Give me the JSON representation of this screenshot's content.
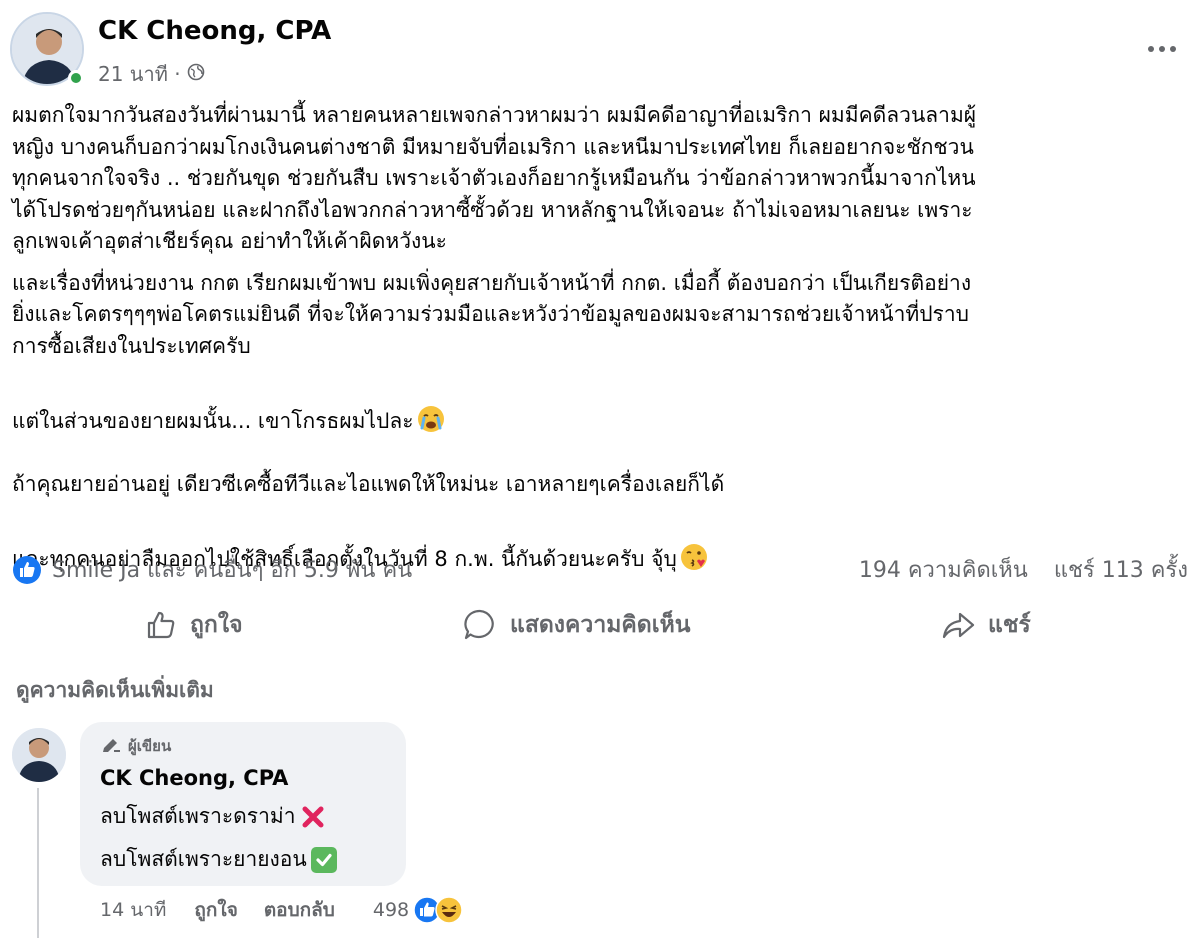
{
  "post": {
    "author": "CK Cheong, CPA",
    "time": "21 นาที ·",
    "paragraphs": [
      "ผมตกใจมากวันสองวันที่ผ่านมานี้ หลายคนหลายเพจกล่าวหาผมว่า ผมมีคดีอาญาที่อเมริกา ผมมีคดีลวนลามผู้\nหญิง บางคนก็บอกว่าผมโกงเงินคนต่างชาติ มีหมายจับที่อเมริกา  และหนีมาประเทศไทย ก็เลยอยากจะชักชวน\nทุกคนจากใจจริง .. ช่วยกันขุด ช่วยกันสืบ เพราะเจ้าตัวเองก็อยากรู้เหมือนกัน ว่าข้อกล่าวหาพวกนี้มาจากไหน\nได้โปรดช่วยๆกันหน่อย และฝากถึงไอพวกกล่าวหาซี้ซั้วด้วย หาหลักฐานให้เจอนะ ถ้าไม่เจอหมาเลยนะ เพราะ\nลูกเพจเค้าอุตส่าเชียร์คุณ อย่าทำให้เค้าผิดหวังนะ",
      "และเรื่องที่หน่วยงาน กกต เรียกผมเข้าพบ ผมเพิ่งคุยสายกับเจ้าหน้าที่ กกต. เมื่อกี้ ต้องบอกว่า เป็นเกียรติอย่าง\nยิ่งและโคตรๆๆๆพ่อโคตรแม่ยินดี ที่จะให้ความร่วมมือและหวังว่าข้อมูลของผมจะสามารถช่วยเจ้าหน้าที่ปราบ\nการซื้อเสียงในประเทศครับ",
      "แต่ในส่วนของยายผมนั้น... เขาโกรธผมไปละ",
      "และทุกคนอย่าลืมออกไปใช้สิทธิ์เลือกตั้งในวันที่ 8 ก.พ. นี้กันด้วยนะครับ จุ้บุ"
    ],
    "paragraph3_line2": "ถ้าคุณยายอ่านอยู่ เดียวซีเคซื้อทีวีและไอแพดให้ใหม่นะ เอาหลายๆเครื่องเลยก็ได้"
  },
  "stats": {
    "reactions": "Smile Ja และ คนอื่นๆ อีก 5.9 พัน คน",
    "comments": "194 ความคิดเห็น",
    "shares": "แชร์ 113 ครั้ง"
  },
  "actions": {
    "like": "ถูกใจ",
    "comment": "แสดงความคิดเห็น",
    "share": "แชร์"
  },
  "see_more": "ดูความคิดเห็นเพิ่มเติม",
  "comment": {
    "badge": "ผู้เขียน",
    "author": "CK Cheong, CPA",
    "line1": "ลบโพสต์เพราะดราม่า",
    "line2": "ลบโพสต์เพราะยายงอน",
    "time": "14 นาที",
    "like": "ถูกใจ",
    "reply": "ตอบกลับ",
    "reaction_count": "498"
  },
  "colors": {
    "facebook_blue": "#1877f2",
    "secondary_text": "#65676b",
    "online_green": "#31a24c",
    "bubble_bg": "#f0f2f5"
  },
  "icons": [
    "globe-icon",
    "more-icon",
    "like-icon",
    "comment-icon",
    "share-icon",
    "pencil-icon",
    "cross-mark-icon",
    "check-mark-icon",
    "crying-emoji-icon",
    "kiss-emoji-icon",
    "laugh-emoji-icon"
  ]
}
